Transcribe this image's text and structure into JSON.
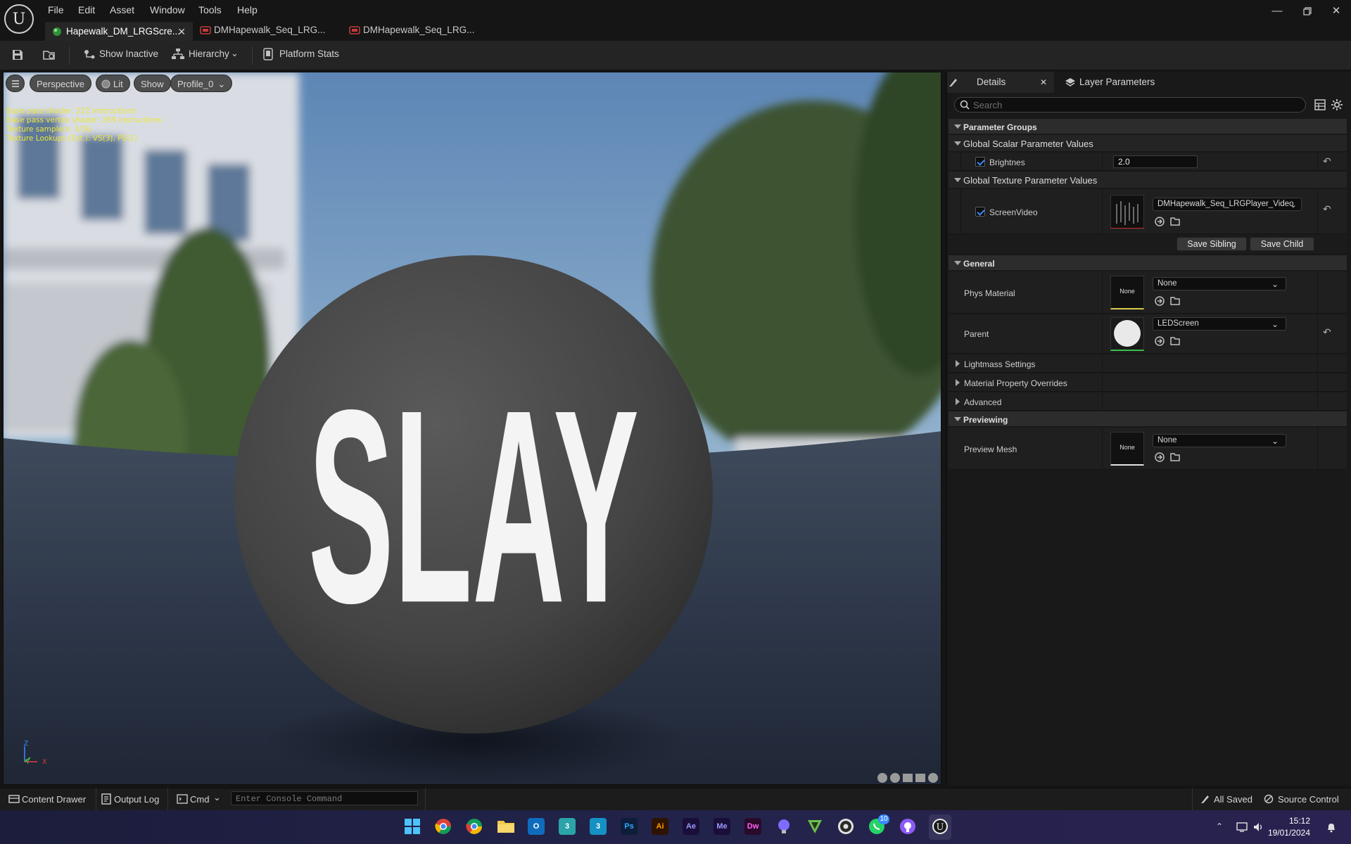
{
  "app": {
    "logo": "U",
    "menu": [
      "File",
      "Edit",
      "Asset",
      "Window",
      "Tools",
      "Help"
    ]
  },
  "tabs": [
    {
      "label": "Hapewalk_DM_LRGScre...",
      "active": true
    },
    {
      "label": "DMHapewalk_Seq_LRG...",
      "active": false
    },
    {
      "label": "DMHapewalk_Seq_LRG...",
      "active": false
    }
  ],
  "toolbar": {
    "show_inactive": "Show Inactive",
    "hierarchy": "Hierarchy",
    "platform_stats": "Platform Stats"
  },
  "viewport": {
    "perspective": "Perspective",
    "lit": "Lit",
    "show": "Show",
    "profile": "Profile_0",
    "stats": [
      "Base pass shader: 222 instructions",
      "Base pass vertex shader: 269 instructions",
      "Texture samplers: 3/16",
      "Texture Lookups (Est.): VS(3), PS(1)"
    ],
    "sphere_text": "SLAY",
    "axis": {
      "z": "Z",
      "y": "Y",
      "x": "X"
    }
  },
  "details": {
    "tab_details": "Details",
    "tab_layers": "Layer Parameters",
    "search_placeholder": "Search",
    "parameter_groups": "Parameter Groups",
    "global_scalar": "Global Scalar Parameter Values",
    "brightness_label": "Brightnes",
    "brightness_value": "2.0",
    "global_texture": "Global Texture Parameter Values",
    "screenvideo_label": "ScreenVideo",
    "screenvideo_value": "DMHapewalk_Seq_LRGPlayer_Video",
    "save_sibling": "Save Sibling",
    "save_child": "Save Child",
    "general": "General",
    "phys_material_label": "Phys Material",
    "phys_material_value": "None",
    "phys_thumb_text": "None",
    "parent_label": "Parent",
    "parent_value": "LEDScreen",
    "lightmass": "Lightmass Settings",
    "material_overrides": "Material Property Overrides",
    "advanced": "Advanced",
    "previewing": "Previewing",
    "preview_mesh_label": "Preview Mesh",
    "preview_mesh_value": "None",
    "preview_thumb_text": "None"
  },
  "statusbar": {
    "content_drawer": "Content Drawer",
    "output_log": "Output Log",
    "cmd": "Cmd",
    "console_placeholder": "Enter Console Command",
    "all_saved": "All Saved",
    "source_control": "Source Control"
  },
  "taskbar": {
    "time": "15:12",
    "date": "19/01/2024",
    "whatsapp_badge": "10",
    "apps": [
      "windows-start",
      "chrome-beta",
      "chrome-beta-2",
      "file-explorer",
      "outlook",
      "3ds-app",
      "3ds-max",
      "photoshop",
      "illustrator",
      "after-effects",
      "media-encoder",
      "dreamweaver",
      "light-app",
      "v-app",
      "obs",
      "whatsapp",
      "github",
      "unreal"
    ]
  }
}
